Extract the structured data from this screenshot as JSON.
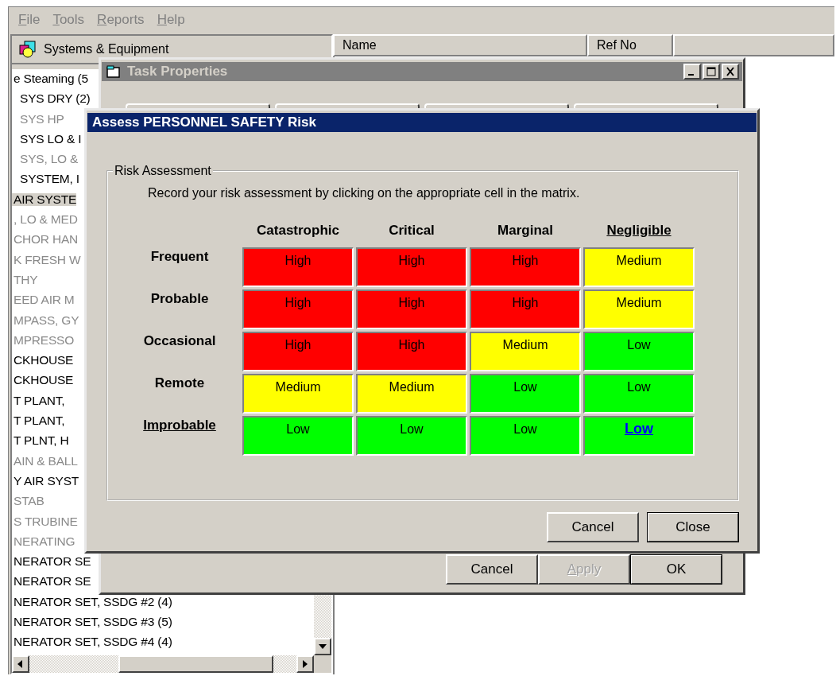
{
  "menu": [
    "File",
    "Tools",
    "Reports",
    "Help"
  ],
  "tree": {
    "header": "Systems & Equipment",
    "items": [
      {
        "text": "e Steaming (5",
        "dimmed": false,
        "selected": false,
        "children": [
          {
            "text": "SYS DRY (2)",
            "dimmed": false,
            "selected": false
          },
          {
            "text": "SYS HP",
            "dimmed": true,
            "selected": false
          },
          {
            "text": "SYS LO & I",
            "dimmed": false,
            "selected": false
          },
          {
            "text": "SYS, LO &",
            "dimmed": true,
            "selected": false
          },
          {
            "text": "SYSTEM, I",
            "dimmed": false,
            "selected": false
          }
        ]
      },
      {
        "text": "AIR SYSTE",
        "dimmed": false,
        "selected": true
      },
      {
        "text": ", LO & MED",
        "dimmed": true,
        "selected": false
      },
      {
        "text": "CHOR HAN",
        "dimmed": true,
        "selected": false
      },
      {
        "text": "K FRESH W",
        "dimmed": true,
        "selected": false
      },
      {
        "text": "THY",
        "dimmed": true,
        "selected": false
      },
      {
        "text": "EED AIR M",
        "dimmed": true,
        "selected": false
      },
      {
        "text": "MPASS, GY",
        "dimmed": true,
        "selected": false
      },
      {
        "text": "MPRESSO",
        "dimmed": true,
        "selected": false
      },
      {
        "text": "CKHOUSE",
        "dimmed": false,
        "selected": false
      },
      {
        "text": "CKHOUSE",
        "dimmed": false,
        "selected": false
      },
      {
        "text": "T PLANT,",
        "dimmed": false,
        "selected": false
      },
      {
        "text": "T PLANT,",
        "dimmed": false,
        "selected": false
      },
      {
        "text": "T PLNT, H",
        "dimmed": false,
        "selected": false
      },
      {
        "text": "AIN & BALL",
        "dimmed": true,
        "selected": false
      },
      {
        "text": "Y AIR SYST",
        "dimmed": false,
        "selected": false
      },
      {
        "text": "STAB",
        "dimmed": true,
        "selected": false
      },
      {
        "text": "S TRUBINE",
        "dimmed": true,
        "selected": false
      },
      {
        "text": "NERATING",
        "dimmed": true,
        "selected": false
      },
      {
        "text": "NERATOR SE",
        "dimmed": false,
        "selected": false
      },
      {
        "text": "NERATOR SE",
        "dimmed": false,
        "selected": false
      },
      {
        "text": "NERATOR SET, SSDG #2 (4)",
        "dimmed": false,
        "selected": false
      },
      {
        "text": "NERATOR SET, SSDG #3 (5)",
        "dimmed": false,
        "selected": false
      },
      {
        "text": "NERATOR SET, SSDG #4 (4)",
        "dimmed": false,
        "selected": false
      }
    ]
  },
  "list": {
    "columns": [
      "Name",
      "Ref No"
    ]
  },
  "task_window": {
    "title": "Task Properties",
    "buttons": [
      {
        "label": "Cancel",
        "disabled": false,
        "default": false
      },
      {
        "label": "Apply",
        "disabled": true,
        "default": false
      },
      {
        "label": "OK",
        "disabled": false,
        "default": true
      }
    ]
  },
  "risk_dialog": {
    "title": "Assess PERSONNEL SAFETY Risk",
    "group": "Risk Assessment",
    "instruction": "Record your risk assessment by clicking on the appropriate cell in the matrix.",
    "severities": [
      {
        "label": "Catastrophic",
        "selected": false
      },
      {
        "label": "Critical",
        "selected": false
      },
      {
        "label": "Marginal",
        "selected": false
      },
      {
        "label": "Negligible",
        "selected": true
      }
    ],
    "likelihoods": [
      {
        "label": "Frequent",
        "selected": false,
        "cells": [
          {
            "label": "High",
            "color": "#ff0000",
            "selected": false
          },
          {
            "label": "High",
            "color": "#ff0000",
            "selected": false
          },
          {
            "label": "High",
            "color": "#ff0000",
            "selected": false
          },
          {
            "label": "Medium",
            "color": "#ffff00",
            "selected": false
          }
        ]
      },
      {
        "label": "Probable",
        "selected": false,
        "cells": [
          {
            "label": "High",
            "color": "#ff0000",
            "selected": false
          },
          {
            "label": "High",
            "color": "#ff0000",
            "selected": false
          },
          {
            "label": "High",
            "color": "#ff0000",
            "selected": false
          },
          {
            "label": "Medium",
            "color": "#ffff00",
            "selected": false
          }
        ]
      },
      {
        "label": "Occasional",
        "selected": false,
        "cells": [
          {
            "label": "High",
            "color": "#ff0000",
            "selected": false
          },
          {
            "label": "High",
            "color": "#ff0000",
            "selected": false
          },
          {
            "label": "Medium",
            "color": "#ffff00",
            "selected": false
          },
          {
            "label": "Low",
            "color": "#00ff00",
            "selected": false
          }
        ]
      },
      {
        "label": "Remote",
        "selected": false,
        "cells": [
          {
            "label": "Medium",
            "color": "#ffff00",
            "selected": false
          },
          {
            "label": "Medium",
            "color": "#ffff00",
            "selected": false
          },
          {
            "label": "Low",
            "color": "#00ff00",
            "selected": false
          },
          {
            "label": "Low",
            "color": "#00ff00",
            "selected": false
          }
        ]
      },
      {
        "label": "Improbable",
        "selected": true,
        "cells": [
          {
            "label": "Low",
            "color": "#00ff00",
            "selected": false
          },
          {
            "label": "Low",
            "color": "#00ff00",
            "selected": false
          },
          {
            "label": "Low",
            "color": "#00ff00",
            "selected": false
          },
          {
            "label": "Low",
            "color": "#00ff00",
            "selected": true
          }
        ]
      }
    ],
    "buttons": [
      {
        "label": "Cancel",
        "default": false
      },
      {
        "label": "Close",
        "default": true
      }
    ]
  }
}
